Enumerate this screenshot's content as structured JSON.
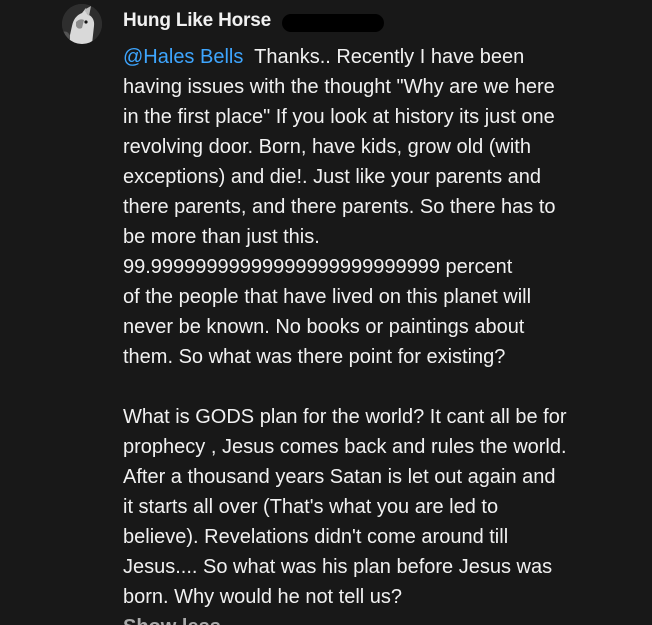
{
  "comment": {
    "author": "Hung Like Horse",
    "mention": "@Hales Bells",
    "paragraph1": [
      "Thanks.. Recently I have been",
      "having issues with the thought \"Why are we here",
      "in the first place\" If you look at history its just one",
      "revolving door. Born, have kids, grow old (with",
      "exceptions) and die!. Just like your parents and",
      "there parents, and there parents. So there has to",
      "be more than just this.",
      "99.99999999999999999999999999 percent",
      "of the people that have lived on this planet will",
      "never be known. No books or paintings about",
      "them. So what was there point for existing?"
    ],
    "paragraph2": [
      "What is GODS plan for the world? It cant all be for",
      "prophecy , Jesus comes back and rules the world.",
      "After a thousand years Satan is let out again and",
      "it starts all over (That's what you are led to",
      "believe). Revelations didn't come around till",
      "Jesus.... So what was his plan  before Jesus was",
      "born. Why would he not tell us?"
    ],
    "read_more": "Show less"
  },
  "colors": {
    "background": "#181818",
    "text": "#f1f1f1",
    "mention": "#3ea6ff",
    "redaction": "#000000"
  }
}
